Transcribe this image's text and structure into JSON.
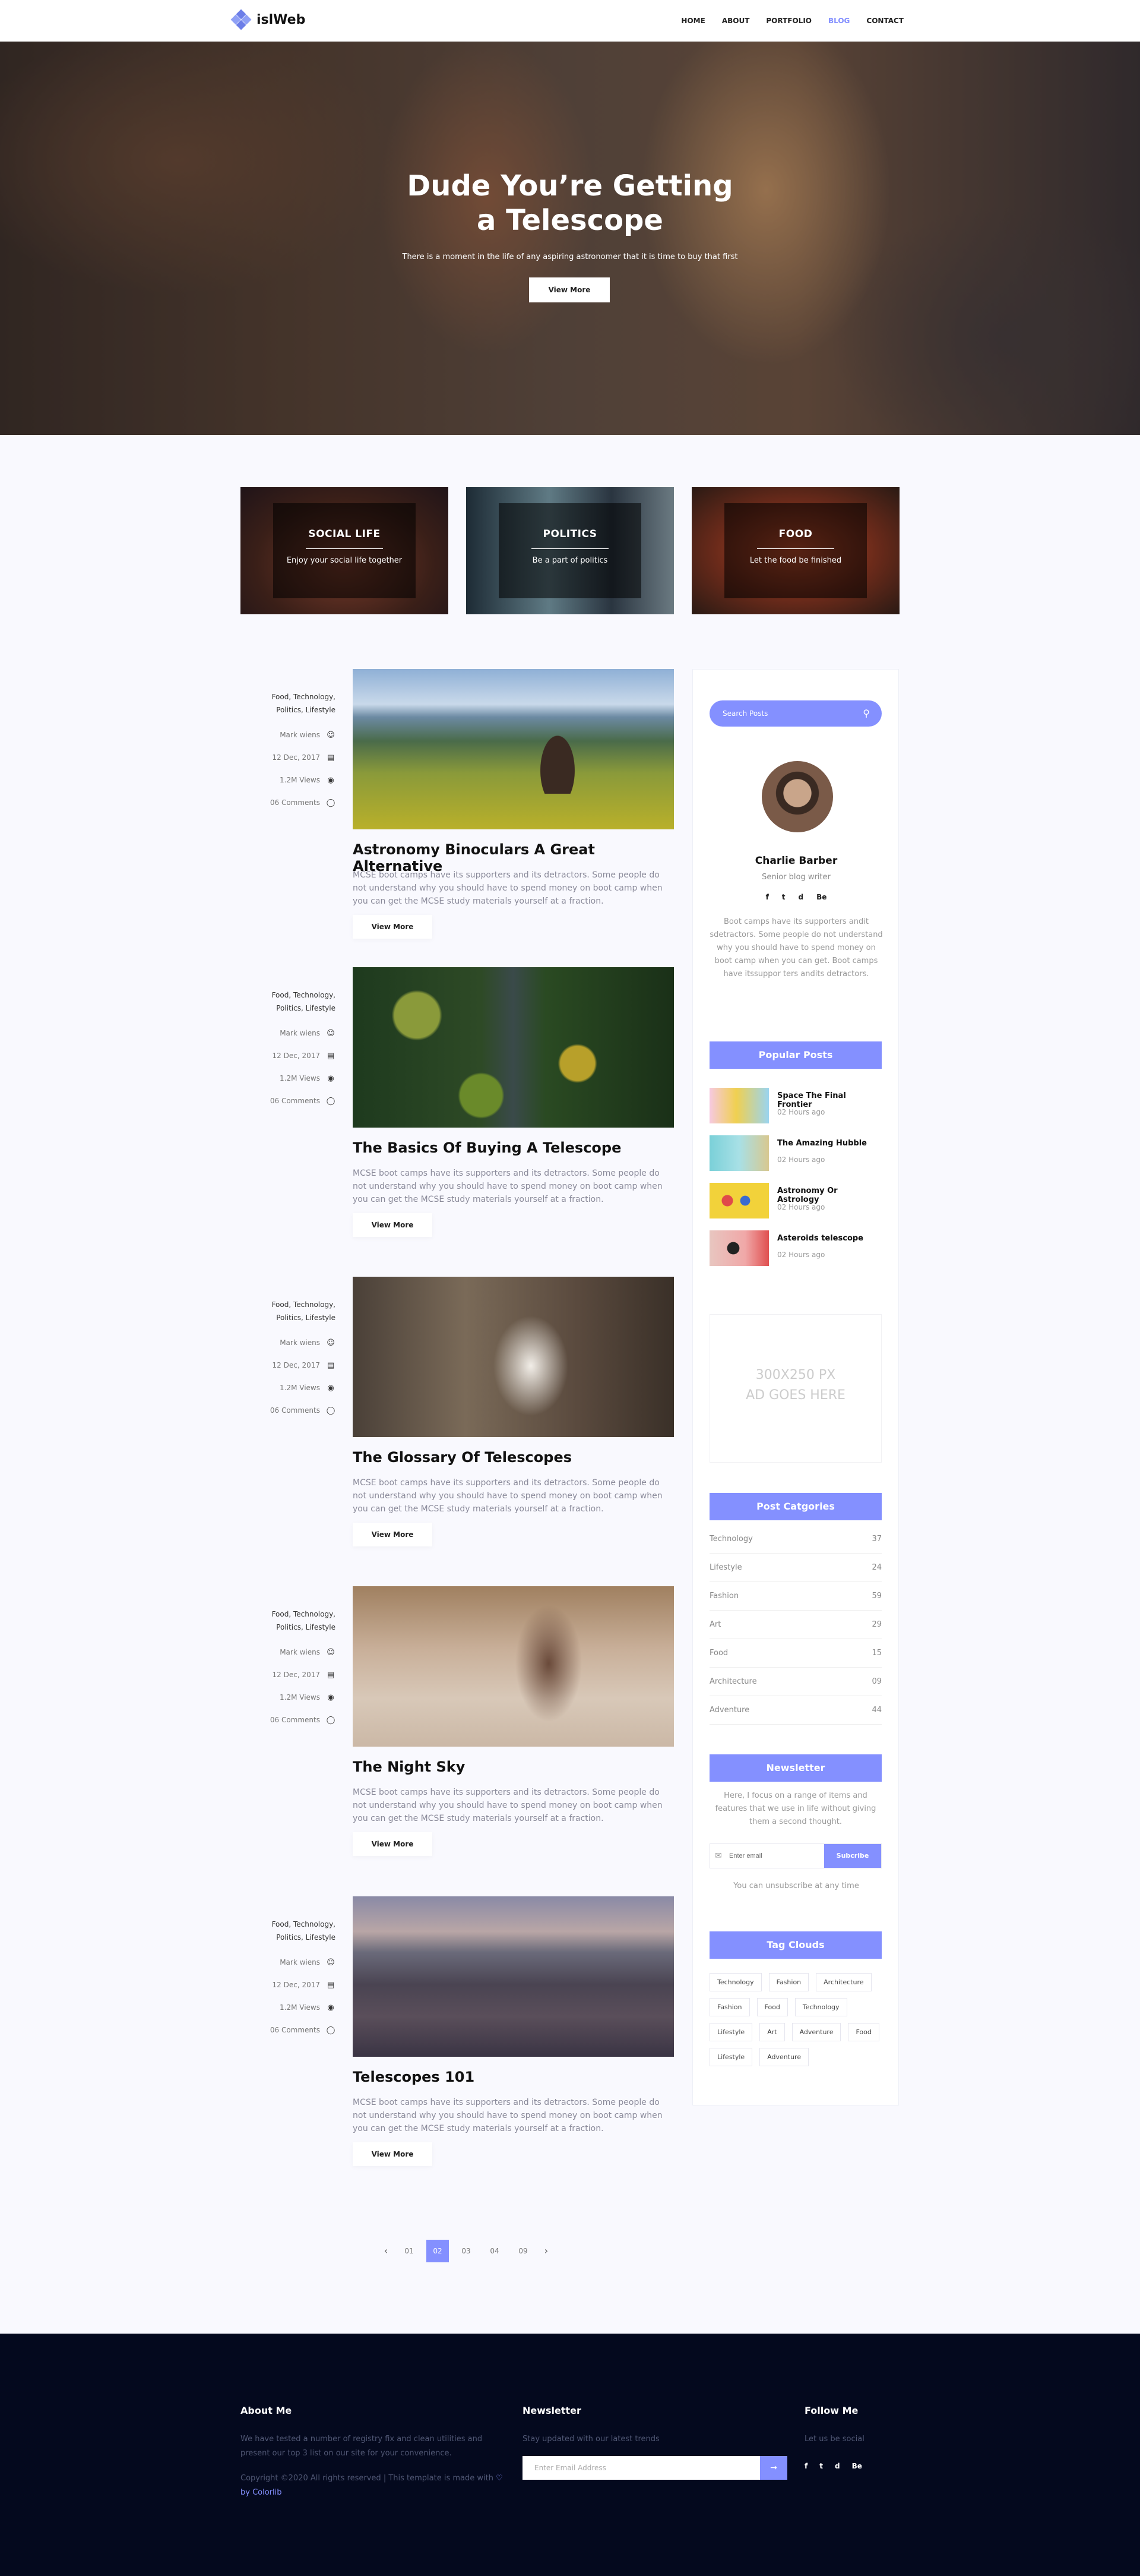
{
  "header": {
    "logo_text": "islWeb",
    "nav": [
      "HOME",
      "ABOUT",
      "PORTFOLIO",
      "BLOG",
      "CONTACT"
    ],
    "active_nav": "BLOG"
  },
  "hero": {
    "title_line1": "Dude You’re Getting",
    "title_line2": "a Telescope",
    "subtitle": "There is a moment in the life of any aspiring astronomer that it is time to buy that first",
    "button": "View More"
  },
  "categories": [
    {
      "title": "SOCIAL LIFE",
      "subtitle": "Enjoy your social life together"
    },
    {
      "title": "POLITICS",
      "subtitle": "Be a part of politics"
    },
    {
      "title": "FOOD",
      "subtitle": "Let the food be finished"
    }
  ],
  "posts": [
    {
      "tags_line1": "Food, Technology,",
      "tags_line2": "Politics, Lifestyle",
      "author": "Mark wiens",
      "date": "12 Dec, 2017",
      "views": "1.2M Views",
      "comments": "06 Comments",
      "title": "Astronomy Binoculars A Great Alternative",
      "excerpt": "MCSE boot camps have its supporters and its detractors. Some people do not understand why you should have to spend money on boot camp when you can get the MCSE study materials yourself at a fraction.",
      "button": "View More"
    },
    {
      "tags_line1": "Food, Technology,",
      "tags_line2": "Politics, Lifestyle",
      "author": "Mark wiens",
      "date": "12 Dec, 2017",
      "views": "1.2M Views",
      "comments": "06 Comments",
      "title": "The Basics Of Buying A Telescope",
      "excerpt": "MCSE boot camps have its supporters and its detractors. Some people do not understand why you should have to spend money on boot camp when you can get the MCSE study materials yourself at a fraction.",
      "button": "View More"
    },
    {
      "tags_line1": "Food, Technology,",
      "tags_line2": "Politics, Lifestyle",
      "author": "Mark wiens",
      "date": "12 Dec, 2017",
      "views": "1.2M Views",
      "comments": "06 Comments",
      "title": "The Glossary Of Telescopes",
      "excerpt": "MCSE boot camps have its supporters and its detractors. Some people do not understand why you should have to spend money on boot camp when you can get the MCSE study materials yourself at a fraction.",
      "button": "View More"
    },
    {
      "tags_line1": "Food, Technology,",
      "tags_line2": "Politics, Lifestyle",
      "author": "Mark wiens",
      "date": "12 Dec, 2017",
      "views": "1.2M Views",
      "comments": "06 Comments",
      "title": "The Night Sky",
      "excerpt": "MCSE boot camps have its supporters and its detractors. Some people do not understand why you should have to spend money on boot camp when you can get the MCSE study materials yourself at a fraction.",
      "button": "View More"
    },
    {
      "tags_line1": "Food, Technology,",
      "tags_line2": "Politics, Lifestyle",
      "author": "Mark wiens",
      "date": "12 Dec, 2017",
      "views": "1.2M Views",
      "comments": "06 Comments",
      "title": "Telescopes 101",
      "excerpt": "MCSE boot camps have its supporters and its detractors. Some people do not understand why you should have to spend money on boot camp when you can get the MCSE study materials yourself at a fraction.",
      "button": "View More"
    }
  ],
  "sidebar": {
    "search_placeholder": "Search Posts",
    "author": {
      "name": "Charlie Barber",
      "role": "Senior blog writer",
      "social": [
        "f",
        "t",
        "d",
        "Be"
      ],
      "bio": "Boot camps have its supporters andit sdetractors. Some people do not understand why you should have to spend money on boot camp when you can get. Boot camps have itssuppor ters andits detractors."
    },
    "popular_title": "Popular Posts",
    "popular": [
      {
        "title": "Space The Final Frontier",
        "time": "02 Hours ago"
      },
      {
        "title": "The Amazing Hubble",
        "time": "02 Hours ago"
      },
      {
        "title": "Astronomy Or Astrology",
        "time": "02 Hours ago"
      },
      {
        "title": "Asteroids telescope",
        "time": "02 Hours ago"
      }
    ],
    "ad_line1": "300X250 PX",
    "ad_line2": "AD GOES HERE",
    "categories_title": "Post Catgories",
    "categories": [
      {
        "name": "Technology",
        "count": "37"
      },
      {
        "name": "Lifestyle",
        "count": "24"
      },
      {
        "name": "Fashion",
        "count": "59"
      },
      {
        "name": "Art",
        "count": "29"
      },
      {
        "name": "Food",
        "count": "15"
      },
      {
        "name": "Architecture",
        "count": "09"
      },
      {
        "name": "Adventure",
        "count": "44"
      }
    ],
    "newsletter_title": "Newsletter",
    "newsletter_text": "Here, I focus on a range of items and features that we use in life without giving them a second thought.",
    "newsletter_placeholder": "Enter email",
    "newsletter_button": "Subcribe",
    "newsletter_note": "You can unsubscribe at any time",
    "tags_title": "Tag Clouds",
    "tags": [
      "Technology",
      "Fashion",
      "Architecture",
      "Fashion",
      "Food",
      "Technology",
      "Lifestyle",
      "Art",
      "Adventure",
      "Food",
      "Lifestyle",
      "Adventure"
    ]
  },
  "pagination": {
    "pages": [
      "01",
      "02",
      "03",
      "04",
      "09"
    ],
    "active": "02",
    "prev": "‹",
    "next": "›"
  },
  "footer": {
    "about_title": "About Me",
    "about_text": "We have tested a number of registry fix and clean utilities and present our top 3 list on our site for your convenience.",
    "copyright": "Copyright ©2020 All rights reserved | This template is made with",
    "credit": "♡ by Colorlib",
    "newsletter_title": "Newsletter",
    "newsletter_text": "Stay updated with our latest trends",
    "email_placeholder": "Enter Email Address",
    "email_button": "→",
    "follow_title": "Follow Me",
    "follow_text": "Let us be social",
    "social": [
      "f",
      "t",
      "d",
      "Be"
    ]
  },
  "colors": {
    "accent": "#8490ff",
    "footer_bg": "#04091e",
    "page_bg": "#f9f9fe"
  }
}
